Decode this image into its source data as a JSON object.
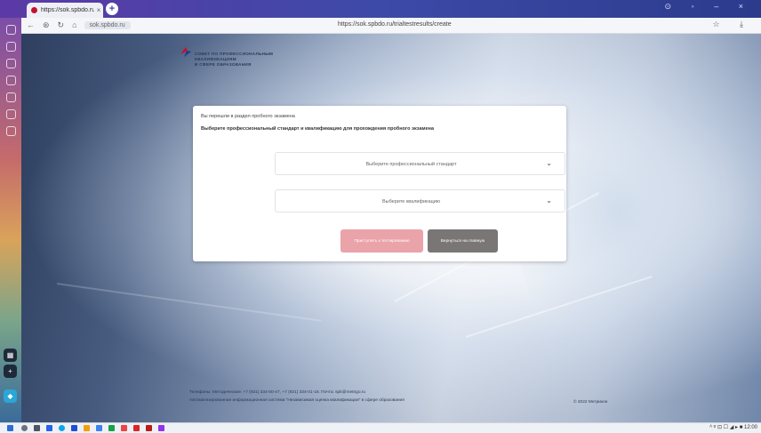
{
  "browser": {
    "tab_title": "https://sok.spbdo.ru/i",
    "tab_close": "×",
    "new_tab": "+",
    "window_controls": "⊙ ◦ – ×",
    "nav_buttons": [
      "←",
      "⊛",
      "↻",
      "⌂"
    ],
    "site_chip": "sok.spbdo.ru",
    "url": "https://sok.spbdo.ru/trialtestresults/create",
    "right_icons": "☆ ⤓"
  },
  "page": {
    "logo_lines": [
      "СОВЕТ ПО ПРОФЕССИОНАЛЬНЫМ",
      "КВАЛИФИКАЦИЯМ",
      "В СФЕРЕ ОБРАЗОВАНИЯ"
    ],
    "card": {
      "line1": "Вы перешли в раздел пробного экзамена",
      "line2": "Выберите профессиональный стандарт и квалификацию для прохождения пробного экзамена",
      "select_standard": "Выберите профессиональный стандарт",
      "select_qualification": "Выберите квалификацию",
      "chevron": "⌄",
      "btn_start": "Приступить к тестированию",
      "btn_back": "Вернуться на главную"
    },
    "footer_line1": "Телефоны: Методические: +7 (921) 334-00-47, +7 (921) 334-01-18. Почта: spk@metrigo.ru",
    "footer_line2": "Автоматизированная информационная система \"Независимая оценка квалификации\" в сфере образования",
    "copyright": "© 2022 Метрикон"
  },
  "taskbar": {
    "tray_text": "ᴬ ᵠ ⊡ ☐ ◢ ▸ ■ 12:00"
  },
  "colors": {
    "accent_red": "#e9a3a9",
    "button_gray": "#7a7675",
    "logo_red": "#c8102e",
    "logo_blue": "#1e3f8a"
  }
}
